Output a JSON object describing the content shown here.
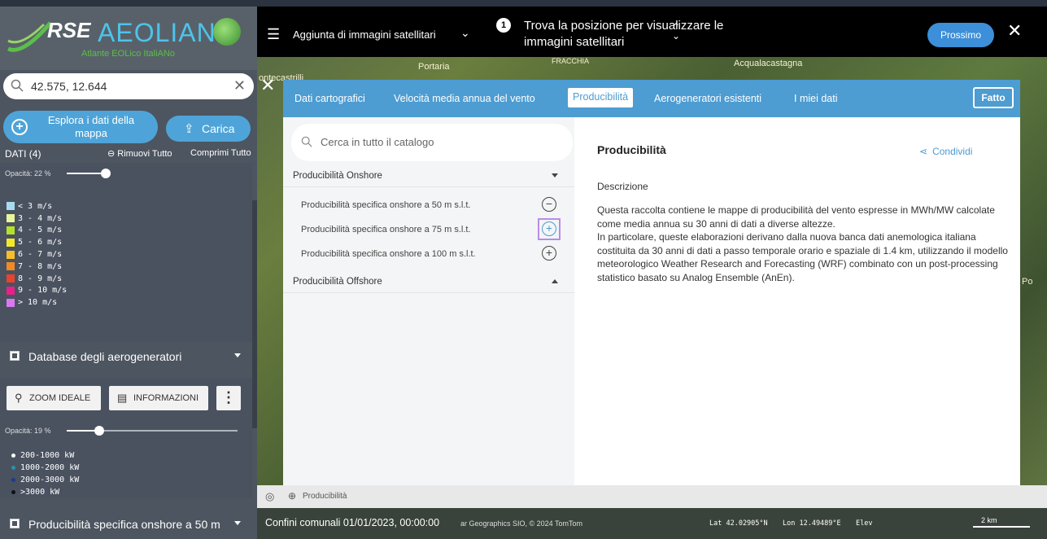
{
  "logo": {
    "brand": "RSE",
    "product": "AEOLIAN",
    "tagline": "Atlante EOLico ItaliANo"
  },
  "sidebar": {
    "search_value": "42.575, 12.644",
    "explore_label": "Esplora i dati della mappa",
    "upload_label": "Carica",
    "data_count_label": "DATI (4)",
    "remove_all_label": "Rimuovi Tutto",
    "collapse_all_label": "Comprimi Tutto",
    "wind_layer": {
      "opacity_label": "Opacità: 22 %",
      "opacity": 0.22,
      "legend": [
        {
          "label": "< 3 m/s",
          "color": "#a6dcf0"
        },
        {
          "label": "3 - 4 m/s",
          "color": "#e8f59a"
        },
        {
          "label": "4 - 5 m/s",
          "color": "#b5e02a"
        },
        {
          "label": "5 - 6 m/s",
          "color": "#f5e82a"
        },
        {
          "label": "6 - 7 m/s",
          "color": "#f7be2a"
        },
        {
          "label": "7 - 8 m/s",
          "color": "#f08a24"
        },
        {
          "label": "8 - 9 m/s",
          "color": "#e8432c"
        },
        {
          "label": "9 - 10 m/s",
          "color": "#e8208a"
        },
        {
          "label": "> 10 m/s",
          "color": "#d77af0"
        }
      ]
    },
    "turbine_layer": {
      "title": "Database degli aerogeneratori",
      "zoom_label": "ZOOM IDEALE",
      "info_label": "INFORMAZIONI",
      "opacity_label": "Opacità: 19 %",
      "opacity": 0.19,
      "legend": [
        {
          "label": "200-1000 kW",
          "color": "#ffffff"
        },
        {
          "label": "1000-2000 kW",
          "color": "#2e8fb0"
        },
        {
          "label": "2000-3000 kW",
          "color": "#1f3a8a"
        },
        {
          "label": ">3000 kW",
          "color": "#111111"
        }
      ]
    },
    "bottom_layer_title": "Producibilità specifica onshore a 50 m"
  },
  "topbar": {
    "menu_title": "Aggiunta di immagini satellitari",
    "step_number": "1",
    "hint": "Trova la posizione per visualizzare le immagini satellitari",
    "next_label": "Prossimo",
    "close_label": "✕"
  },
  "map_labels": [
    "Portaria",
    "FRACCHIA",
    "Acqualacastagna",
    "ontecastrilli",
    "Po"
  ],
  "dialog": {
    "tabs": [
      {
        "label": "Dati cartografici"
      },
      {
        "label": "Velocità media annua del vento"
      },
      {
        "label": "Producibilità"
      },
      {
        "label": "Aerogeneratori esistenti"
      },
      {
        "label": "I miei dati"
      }
    ],
    "done_label": "Fatto",
    "catalog_search_placeholder": "Cerca in tutto il catalogo",
    "groups": [
      {
        "title": "Producibilità Onshore"
      },
      {
        "title": "Producibilità Offshore"
      }
    ],
    "items": [
      {
        "label": "Producibilità specifica onshore a 50 m s.l.t.",
        "state": "remove"
      },
      {
        "label": "Producibilità specifica onshore a 75 m s.l.t.",
        "state": "add"
      },
      {
        "label": "Producibilità specifica onshore a 100 m s.l.t.",
        "state": "add"
      }
    ],
    "detail_title": "Producibilità",
    "share_label": "Condividi",
    "description_label": "Descrizione",
    "description_p1": "Questa raccolta contiene le mappe di producibilità del vento espresse in MWh/MW calcolate come media annua su 30 anni di dati a diverse altezze.",
    "description_p2": "In particolare, queste elaborazioni derivano dalla nuova banca dati anemologica italiana costituita da 30 anni di dati a passo temporale orario e spaziale di 1.4 km, utilizzando il modello meteorologico Weather Research and Forecasting (WRF) combinato con un post-processing statistico basato su Analog Ensemble (AnEn).",
    "footer_label": "Producibilità"
  },
  "statusbar": {
    "boundaries": "Confini comunali 01/01/2023, 00:00:00",
    "copyright": "ar Geographics SIO, © 2024 TomTom",
    "lat": "Lat 42.02905°N",
    "lon": "Lon 12.49489°E",
    "elev": "Elev",
    "scale": "2 km"
  }
}
